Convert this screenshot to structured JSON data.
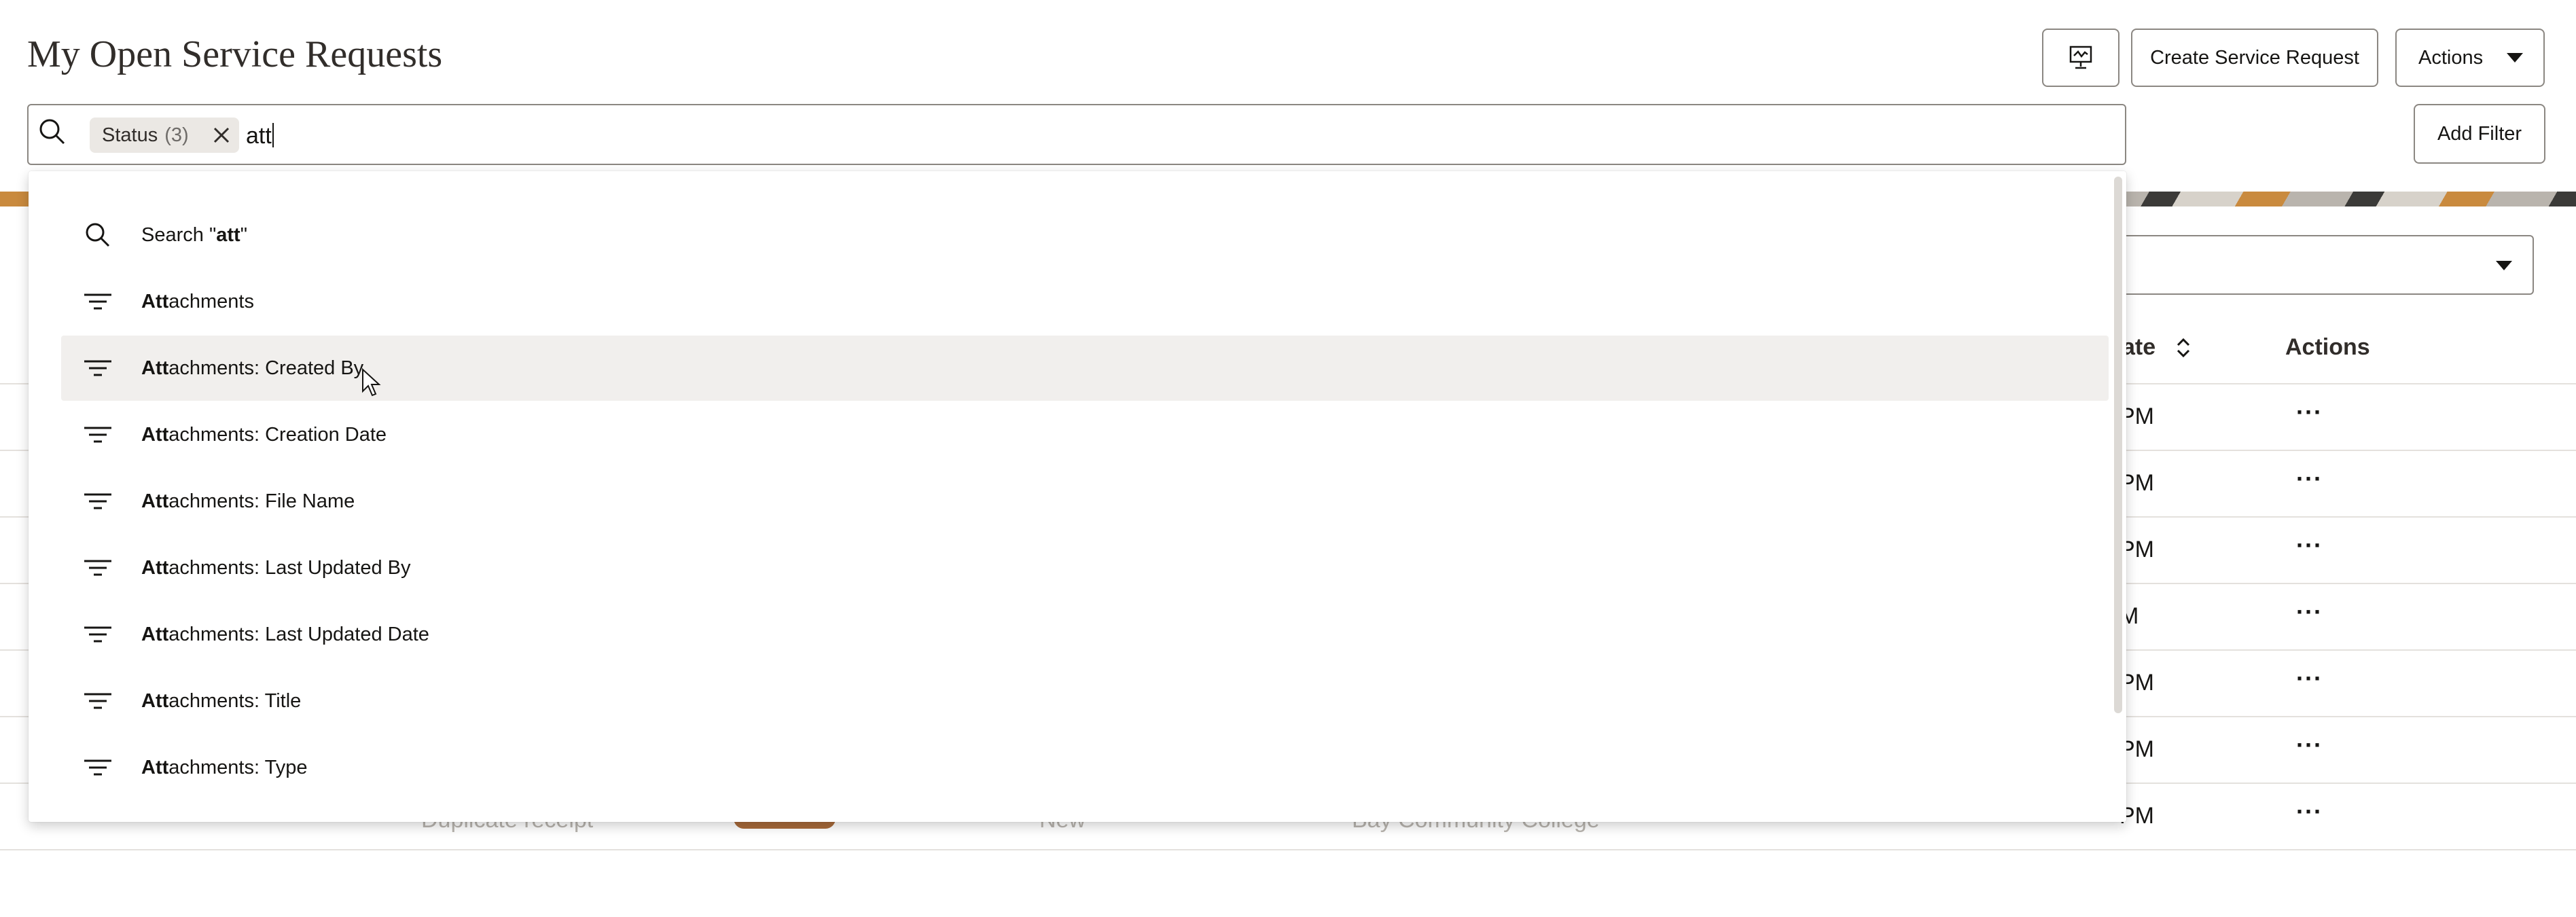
{
  "header": {
    "title": "My Open Service Requests",
    "create_button": "Create Service Request",
    "actions_button": "Actions",
    "add_filter_button": "Add Filter"
  },
  "search": {
    "chip_label": "Status",
    "chip_count": "(3)",
    "query": "att"
  },
  "dropdown": {
    "search_suggestion_prefix": "Search \"",
    "search_suggestion_term": "att",
    "search_suggestion_suffix": "\"",
    "match": "Att",
    "items": [
      {
        "rest": "achments",
        "icon": "filter-icon"
      },
      {
        "rest": "achments: Created By",
        "icon": "filter-icon",
        "highlighted": true
      },
      {
        "rest": "achments: Creation Date",
        "icon": "filter-icon"
      },
      {
        "rest": "achments: File Name",
        "icon": "filter-icon"
      },
      {
        "rest": "achments: Last Updated By",
        "icon": "filter-icon"
      },
      {
        "rest": "achments: Last Updated Date",
        "icon": "filter-icon"
      },
      {
        "rest": "achments: Title",
        "icon": "filter-icon"
      },
      {
        "rest": "achments: Type",
        "icon": "filter-icon"
      }
    ]
  },
  "table": {
    "date_header_visible": "ate",
    "actions_header": "Actions",
    "row_dates": [
      "PM",
      "PM",
      "PM",
      "M",
      "PM",
      "PM",
      "PM"
    ],
    "more_label": "···",
    "ghost_row": [
      "Duplicate receipt",
      "New",
      "Bay Community College"
    ]
  },
  "colors": {
    "accent_text": "#161513",
    "border": "#8b8782",
    "highlight": "#f1efed",
    "badge": "#a86a3a"
  }
}
